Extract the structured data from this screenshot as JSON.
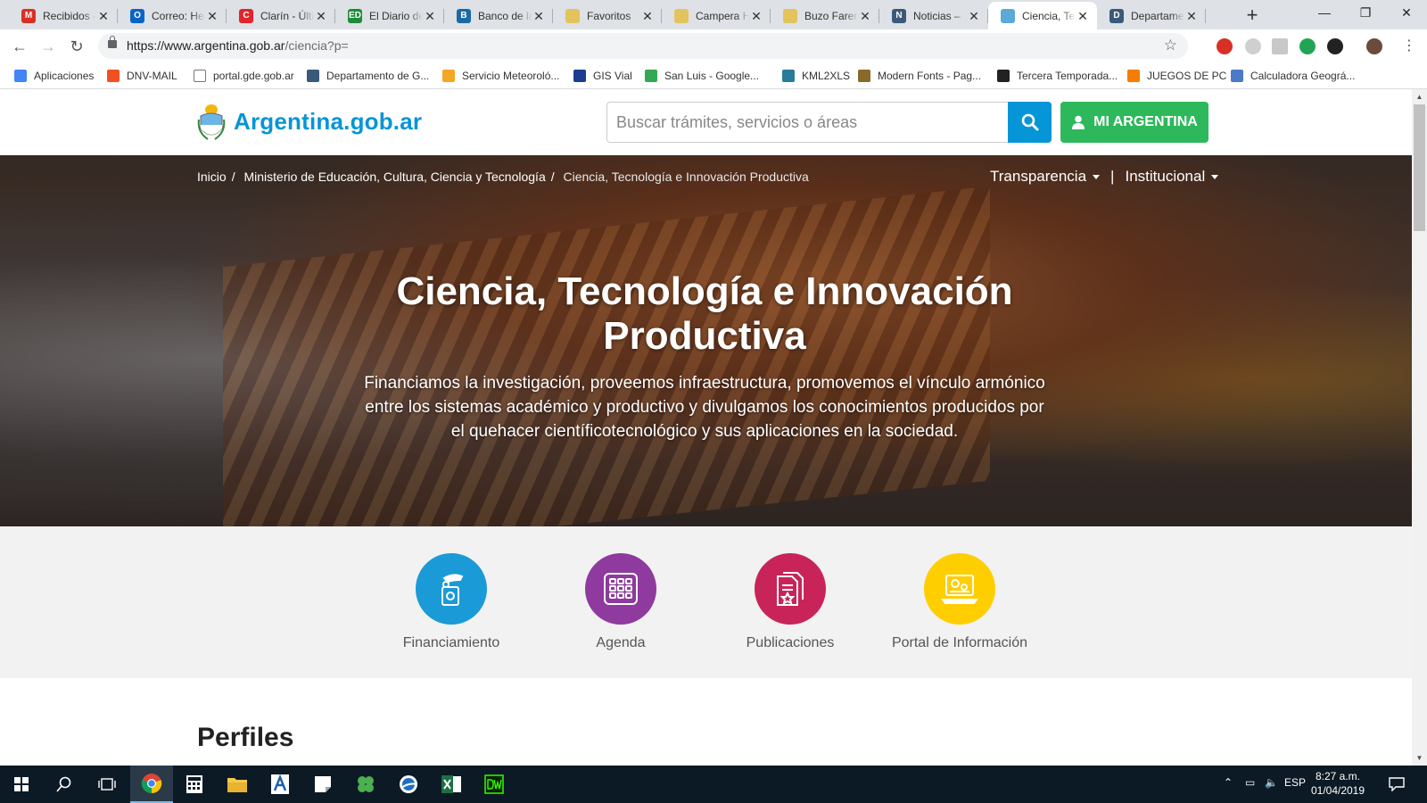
{
  "tabs": [
    {
      "title": "Recibidos - ",
      "icon": "gmail-icon",
      "color": "#d93025",
      "letter": "M"
    },
    {
      "title": "Correo: Her",
      "icon": "outlook-icon",
      "color": "#0a64c8",
      "letter": "O"
    },
    {
      "title": "Clarín - Últi",
      "icon": "clarin-icon",
      "color": "#e1252b",
      "letter": "C"
    },
    {
      "title": "El Diario de",
      "icon": "diario-icon",
      "color": "#1f8b3a",
      "letter": "ED"
    },
    {
      "title": "Banco de la",
      "icon": "banco-icon",
      "color": "#1b6aa5",
      "letter": "B"
    },
    {
      "title": "Favoritos",
      "icon": "favoritos-icon",
      "color": "#e3c35c",
      "letter": ""
    },
    {
      "title": "Campera H",
      "icon": "campera-icon",
      "color": "#e3c35c",
      "letter": ""
    },
    {
      "title": "Buzo Faren",
      "icon": "buzo-icon",
      "color": "#e3c35c",
      "letter": ""
    },
    {
      "title": "Noticias – ",
      "icon": "noticias-icon",
      "color": "#3b5a7a",
      "letter": "N"
    },
    {
      "title": "Ciencia, Tec",
      "icon": "argentina-icon",
      "color": "#5aa9d6",
      "letter": ""
    },
    {
      "title": "Departame",
      "icon": "departamento-icon",
      "color": "#3b5a7a",
      "letter": "D"
    }
  ],
  "browser": {
    "url_host": "https://www.argentina.gob.ar",
    "url_path": "/ciencia?p="
  },
  "bookmarks": [
    {
      "label": "Aplicaciones",
      "icon": "apps-grid-icon",
      "color": "#4285f4"
    },
    {
      "label": "DNV-MAIL",
      "icon": "windows-logo-icon",
      "color": "#f25022"
    },
    {
      "label": "portal.gde.gob.ar",
      "icon": "page-icon",
      "color": "#ffffff"
    },
    {
      "label": "Departamento de G...",
      "icon": "shield-icon",
      "color": "#3b5a7a"
    },
    {
      "label": "Servicio Meteoroló...",
      "icon": "weather-icon",
      "color": "#f5a623"
    },
    {
      "label": "GIS Vial",
      "icon": "v-logo-icon",
      "color": "#1a3d8f"
    },
    {
      "label": "San Luis - Google...",
      "icon": "maps-icon",
      "color": "#34a853"
    },
    {
      "label": "KML2XLS",
      "icon": "gear-icon",
      "color": "#2a7a9a"
    },
    {
      "label": "Modern Fonts - Pag...",
      "icon": "fonts-icon",
      "color": "#8a6a2a"
    },
    {
      "label": "Tercera Temporada...",
      "icon": "badge-icon",
      "color": "#222222"
    },
    {
      "label": "JUEGOS DE PC",
      "icon": "blogger-icon",
      "color": "#f57d00"
    },
    {
      "label": "Calculadora Geográ...",
      "icon": "calendar-icon",
      "color": "#4a7ac8"
    }
  ],
  "site": {
    "logo_text": "Argentina.gob.ar",
    "search_placeholder": "Buscar trámites, servicios o áreas",
    "login_label": "MI ARGENTINA"
  },
  "breadcrumb": [
    "Inicio",
    "Ministerio de Educación, Cultura, Ciencia y Tecnología",
    "Ciencia, Tecnología e Innovación Productiva"
  ],
  "breadcrumb_sep": "/",
  "hero_nav": {
    "transparencia": "Transparencia",
    "separator": "|",
    "institucional": "Institucional"
  },
  "hero": {
    "title": "Ciencia, Tecnología e Innovación Productiva",
    "lead": "Financiamos la investigación, proveemos infraestructura, promovemos el vínculo armónico entre los sistemas académico y productivo y divulgamos los conocimientos producidos por el quehacer científicotecnológico y sus aplicaciones en la sociedad."
  },
  "shortcuts": [
    {
      "label": "Financiamiento",
      "color": "#1a9ad6",
      "icon": "hand-money-icon"
    },
    {
      "label": "Agenda",
      "color": "#8e3a9e",
      "icon": "calendar-grid-icon"
    },
    {
      "label": "Publicaciones",
      "color": "#c8245a",
      "icon": "documents-icon"
    },
    {
      "label": "Portal de Información",
      "color": "#ffce00",
      "icon": "laptop-gears-icon"
    }
  ],
  "section": {
    "title": "Perfiles"
  },
  "taskbar": {
    "language": "ESP",
    "time": "8:27 a.m.",
    "date": "01/04/2019"
  },
  "colors": {
    "brand_blue": "#0695d6",
    "login_green": "#2eb85c",
    "taskbar": "#0c1a26"
  }
}
